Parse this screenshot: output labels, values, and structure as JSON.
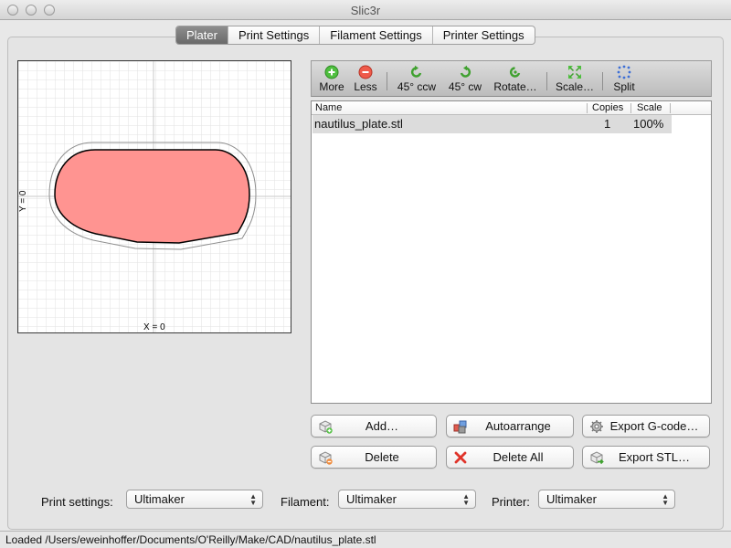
{
  "window": {
    "title": "Slic3r"
  },
  "tabs": [
    "Plater",
    "Print Settings",
    "Filament Settings",
    "Printer Settings"
  ],
  "preview": {
    "x_label": "X = 0",
    "y_label": "Y = 0",
    "object_fill": "#ff9491"
  },
  "toolbar": {
    "more": "More",
    "less": "Less",
    "rotate_ccw": "45° ccw",
    "rotate_cw": "45° cw",
    "rotate": "Rotate…",
    "scale": "Scale…",
    "split": "Split"
  },
  "object_list": {
    "columns": [
      "Name",
      "Copies",
      "Scale"
    ],
    "rows": [
      {
        "name": "nautilus_plate.stl",
        "copies": "1",
        "scale": "100%"
      }
    ]
  },
  "buttons": {
    "add": "Add…",
    "autoarrange": "Autoarrange",
    "export_gcode": "Export G-code…",
    "delete": "Delete",
    "delete_all": "Delete All",
    "export_stl": "Export STL…"
  },
  "footer": {
    "print_label": "Print settings:",
    "print_value": "Ultimaker",
    "filament_label": "Filament:",
    "filament_value": "Ultimaker",
    "printer_label": "Printer:",
    "printer_value": "Ultimaker"
  },
  "status": "Loaded /Users/eweinhoffer/Documents/O'Reilly/Make/CAD/nautilus_plate.stl"
}
